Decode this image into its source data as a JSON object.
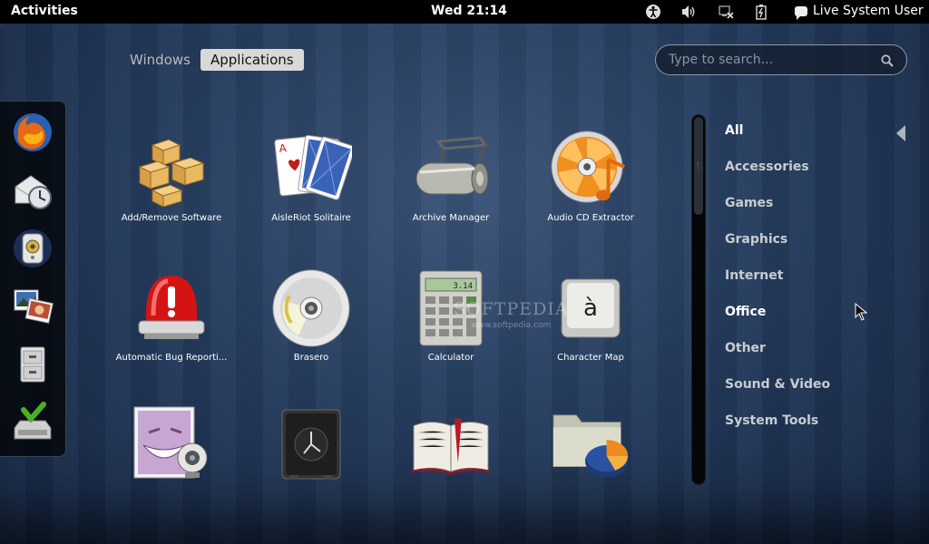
{
  "topbar": {
    "activities": "Activities",
    "clock": "Wed 21:14",
    "user": "Live System User",
    "tray_icons": [
      "accessibility-icon",
      "volume-icon",
      "network-icon",
      "battery-icon"
    ]
  },
  "view_selector": {
    "windows": "Windows",
    "applications": "Applications"
  },
  "search": {
    "placeholder": "Type to search..."
  },
  "dash": {
    "items": [
      "firefox-icon",
      "evolution-mail-icon",
      "rhythmbox-icon",
      "shotwell-photos-icon",
      "files-cabinet-icon",
      "software-install-icon"
    ]
  },
  "apps": [
    {
      "label": "Add/Remove Software",
      "icon": "boxes-icon"
    },
    {
      "label": "AisleRiot Solitaire",
      "icon": "playing-cards-icon"
    },
    {
      "label": "Archive Manager",
      "icon": "archive-roller-icon"
    },
    {
      "label": "Audio CD Extractor",
      "icon": "cd-music-icon"
    },
    {
      "label": "Automatic Bug Reporti...",
      "icon": "siren-alert-icon"
    },
    {
      "label": "Brasero",
      "icon": "disc-burn-icon"
    },
    {
      "label": "Calculator",
      "icon": "calculator-icon"
    },
    {
      "label": "Character Map",
      "icon": "character-key-icon"
    },
    {
      "label": "",
      "icon": "cheese-webcam-icon"
    },
    {
      "label": "",
      "icon": "safe-clock-icon"
    },
    {
      "label": "",
      "icon": "open-book-icon"
    },
    {
      "label": "",
      "icon": "folder-chart-icon"
    }
  ],
  "calculator_display": "3.14",
  "character_map_glyph": "à",
  "categories": [
    {
      "label": "All",
      "selected": true
    },
    {
      "label": "Accessories"
    },
    {
      "label": "Games"
    },
    {
      "label": "Graphics"
    },
    {
      "label": "Internet"
    },
    {
      "label": "Office"
    },
    {
      "label": "Other"
    },
    {
      "label": "Sound & Video"
    },
    {
      "label": "System Tools"
    }
  ],
  "watermark": {
    "name": "SOFTPEDIA",
    "url": "www.softpedia.com"
  },
  "colors": {
    "background": "#263d5e",
    "topbar": "#000000",
    "active_tab": "#d8d8d8"
  }
}
